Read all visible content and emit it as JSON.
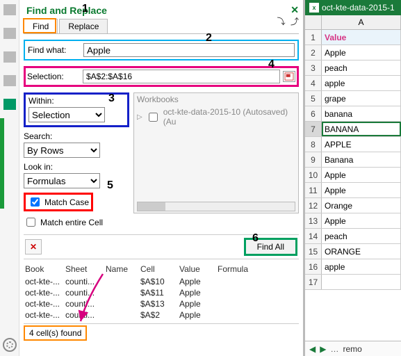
{
  "panel": {
    "title": "Find and Replace",
    "tabs": {
      "find": "Find",
      "replace": "Replace"
    },
    "find_what_label": "Find what:",
    "find_what_value": "Apple",
    "selection_label": "Selection:",
    "selection_value": "$A$2:$A$16",
    "within_label": "Within:",
    "within_value": "Selection",
    "search_label": "Search:",
    "search_value": "By Rows",
    "lookin_label": "Look in:",
    "lookin_value": "Formulas",
    "match_case_label": "Match Case",
    "match_entire_label": "Match entire Cell",
    "workbooks_header": "Workbooks",
    "workbook_item": "oct-kte-data-2015-10 (Autosaved) (Au",
    "find_all_label": "Find All",
    "status": "4 cell(s) found"
  },
  "callouts": {
    "n1": "1",
    "n2": "2",
    "n3": "3",
    "n4": "4",
    "n5": "5",
    "n6": "6"
  },
  "results": {
    "headers": {
      "book": "Book",
      "sheet": "Sheet",
      "name": "Name",
      "cell": "Cell",
      "value": "Value",
      "formula": "Formula"
    },
    "rows": [
      {
        "book": "oct-kte-...",
        "sheet": "counti...",
        "name": "",
        "cell": "$A$10",
        "value": "Apple",
        "formula": ""
      },
      {
        "book": "oct-kte-...",
        "sheet": "counti...",
        "name": "",
        "cell": "$A$11",
        "value": "Apple",
        "formula": ""
      },
      {
        "book": "oct-kte-...",
        "sheet": "counti...",
        "name": "",
        "cell": "$A$13",
        "value": "Apple",
        "formula": ""
      },
      {
        "book": "oct-kte-...",
        "sheet": "counti...",
        "name": "",
        "cell": "$A$2",
        "value": "Apple",
        "formula": ""
      }
    ]
  },
  "sheet": {
    "file_tab": "oct-kte-data-2015-1",
    "col_header": "A",
    "nav_tab": "remo",
    "selected_row": 7,
    "rows": [
      {
        "n": 1,
        "v": "Value",
        "header": true
      },
      {
        "n": 2,
        "v": "Apple"
      },
      {
        "n": 3,
        "v": "peach"
      },
      {
        "n": 4,
        "v": "apple"
      },
      {
        "n": 5,
        "v": "grape"
      },
      {
        "n": 6,
        "v": "banana"
      },
      {
        "n": 7,
        "v": "BANANA"
      },
      {
        "n": 8,
        "v": "APPLE"
      },
      {
        "n": 9,
        "v": "Banana"
      },
      {
        "n": 10,
        "v": "Apple"
      },
      {
        "n": 11,
        "v": "Apple"
      },
      {
        "n": 12,
        "v": "Orange"
      },
      {
        "n": 13,
        "v": "Apple"
      },
      {
        "n": 14,
        "v": "peach"
      },
      {
        "n": 15,
        "v": "ORANGE"
      },
      {
        "n": 16,
        "v": "apple"
      },
      {
        "n": 17,
        "v": ""
      }
    ]
  }
}
